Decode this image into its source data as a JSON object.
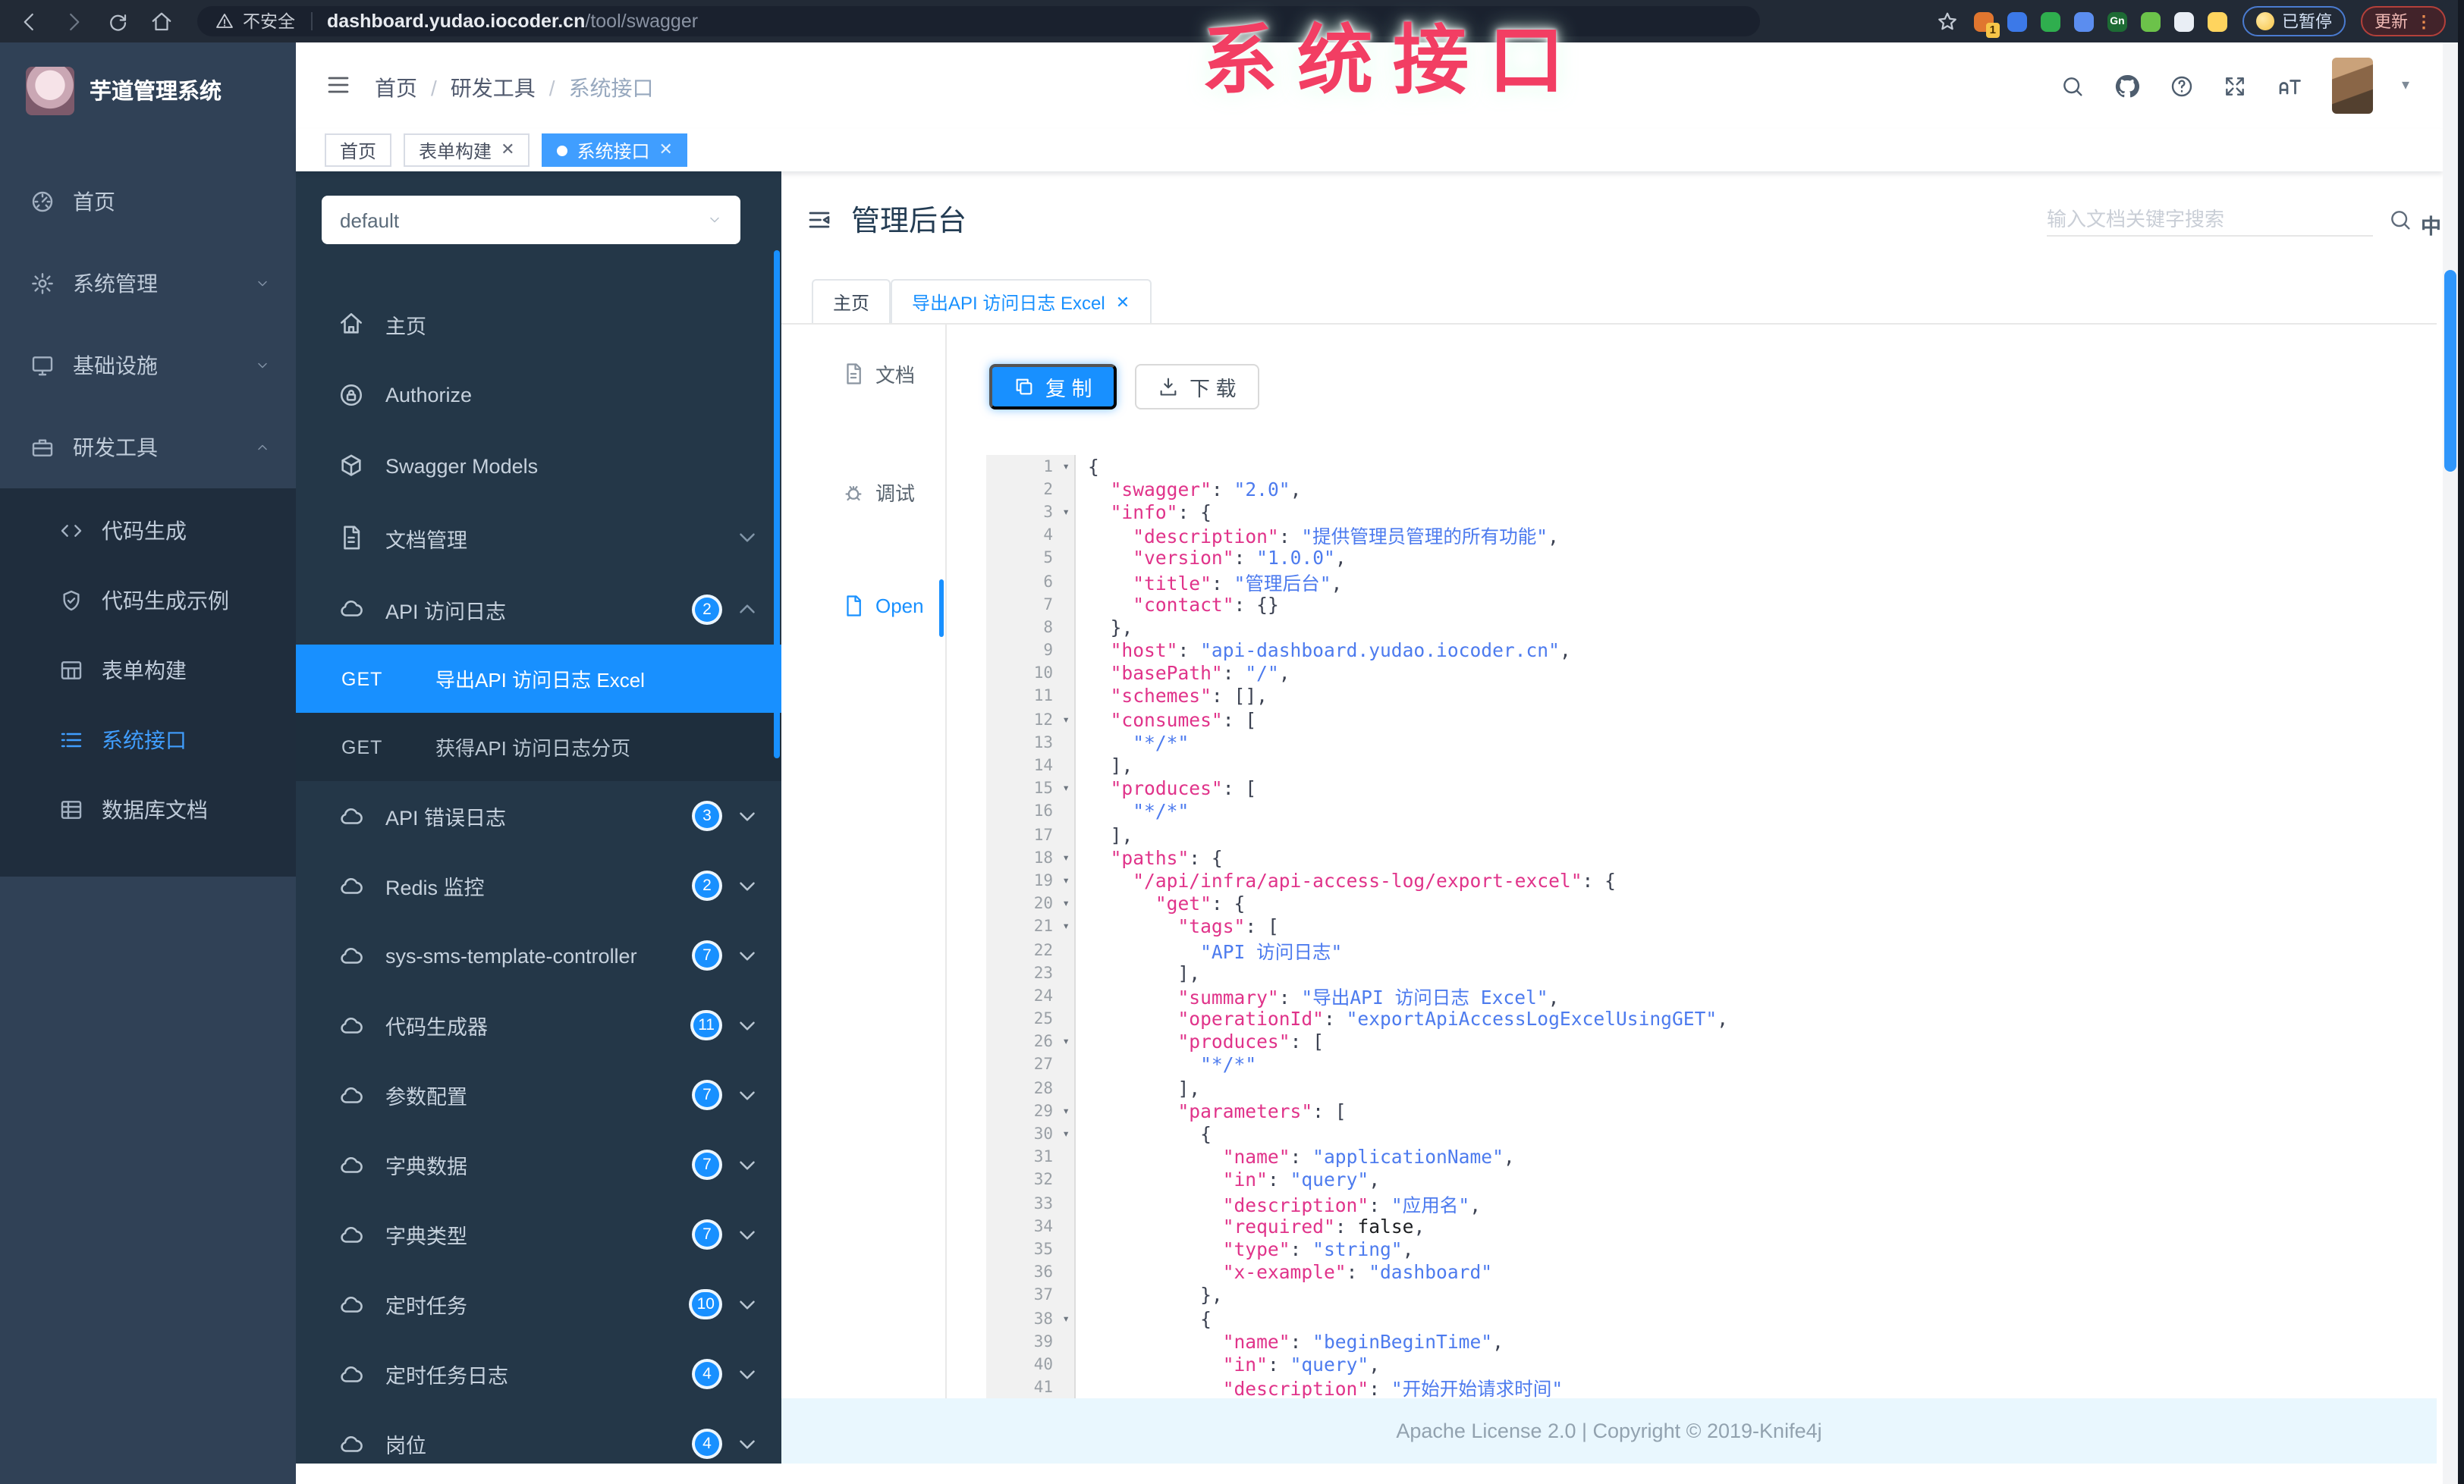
{
  "watermark": "系统接口",
  "colors": {
    "accent": "#1890ff",
    "sidebar": "#304156",
    "sidebar_submenu": "#1f2d3d",
    "swagger_sidebar": "#243748",
    "active_tag": "#409eff",
    "watermark": "#f23e63",
    "code_key": "#e0338a",
    "code_string": "#4d7bee",
    "footer_bg": "#e9f7fe"
  },
  "browser": {
    "security_label": "不安全",
    "url_host": "dashboard.yudao.iocoder.cn",
    "url_path": "/tool/swagger",
    "paused_label": "已暂停",
    "update_label": "更新",
    "menu_dots": "⋮",
    "extensions": [
      {
        "color": "#e0762f",
        "badge": "1"
      },
      {
        "color": "#3c79e8"
      },
      {
        "color": "#2fae4e"
      },
      {
        "color": "#5b8def"
      },
      {
        "color": "#1d6b34",
        "label": "Gn"
      },
      {
        "color": "#6cc24a"
      },
      {
        "color": "#e9eef5"
      },
      {
        "color": "#ffd45e"
      }
    ]
  },
  "app": {
    "logo_title": "芋道管理系统",
    "breadcrumb": [
      "首页",
      "研发工具",
      "系统接口"
    ],
    "tags": [
      {
        "label": "首页"
      },
      {
        "label": "表单构建",
        "closable": true
      },
      {
        "label": "系统接口",
        "closable": true,
        "active": true
      }
    ]
  },
  "sidebar": {
    "items": [
      {
        "icon": "dash",
        "label": "首页"
      },
      {
        "icon": "gear",
        "label": "系统管理",
        "chevron": "down"
      },
      {
        "icon": "monitor",
        "label": "基础设施",
        "chevron": "down"
      },
      {
        "icon": "briefcase",
        "label": "研发工具",
        "chevron": "up"
      }
    ],
    "sub_items": [
      {
        "icon": "code",
        "label": "代码生成"
      },
      {
        "icon": "shield",
        "label": "代码生成示例"
      },
      {
        "icon": "table",
        "label": "表单构建"
      },
      {
        "icon": "list",
        "label": "系统接口",
        "active": true
      },
      {
        "icon": "db",
        "label": "数据库文档"
      }
    ]
  },
  "swagger_nav": {
    "group_select": "default",
    "items": [
      {
        "icon": "house",
        "label": "主页"
      },
      {
        "icon": "lock",
        "label": "Authorize"
      },
      {
        "icon": "cube",
        "label": "Swagger Models"
      },
      {
        "icon": "doc",
        "label": "文档管理",
        "chevron": "down"
      },
      {
        "icon": "cloud",
        "label": "API 访问日志",
        "badge": "2",
        "chevron": "up"
      }
    ],
    "operations": [
      {
        "method": "GET",
        "label": "导出API 访问日志 Excel",
        "active": true
      },
      {
        "method": "GET",
        "label": "获得API 访问日志分页"
      }
    ],
    "groups": [
      {
        "label": "API 错误日志",
        "badge": "3"
      },
      {
        "label": "Redis 监控",
        "badge": "2"
      },
      {
        "label": "sys-sms-template-controller",
        "badge": "7"
      },
      {
        "label": "代码生成器",
        "badge": "11"
      },
      {
        "label": "参数配置",
        "badge": "7"
      },
      {
        "label": "字典数据",
        "badge": "7"
      },
      {
        "label": "字典类型",
        "badge": "7"
      },
      {
        "label": "定时任务",
        "badge": "10"
      },
      {
        "label": "定时任务日志",
        "badge": "4"
      },
      {
        "label": "岗位",
        "badge": "4"
      }
    ]
  },
  "main": {
    "title": "管理后台",
    "search_placeholder": "输入文档关键字搜索",
    "lang_icon": "中",
    "tabs": [
      {
        "label": "主页"
      },
      {
        "label": "导出API 访问日志 Excel",
        "closable": true,
        "active": true
      }
    ],
    "doc_nav": [
      {
        "icon": "doc",
        "label": "文档"
      },
      {
        "icon": "bug",
        "label": "调试"
      },
      {
        "icon": "file",
        "label": "Open",
        "active": true
      }
    ],
    "copy_label": "复 制",
    "download_label": "下 载",
    "fold_lines": [
      1,
      3,
      12,
      15,
      18,
      19,
      20,
      21,
      26,
      29,
      30,
      38
    ],
    "code_lines": [
      "{",
      "  \"swagger\": \"2.0\",",
      "  \"info\": {",
      "    \"description\": \"提供管理员管理的所有功能\",",
      "    \"version\": \"1.0.0\",",
      "    \"title\": \"管理后台\",",
      "    \"contact\": {}",
      "  },",
      "  \"host\": \"api-dashboard.yudao.iocoder.cn\",",
      "  \"basePath\": \"/\",",
      "  \"schemes\": [],",
      "  \"consumes\": [",
      "    \"*/*\"",
      "  ],",
      "  \"produces\": [",
      "    \"*/*\"",
      "  ],",
      "  \"paths\": {",
      "    \"/api/infra/api-access-log/export-excel\": {",
      "      \"get\": {",
      "        \"tags\": [",
      "          \"API 访问日志\"",
      "        ],",
      "        \"summary\": \"导出API 访问日志 Excel\",",
      "        \"operationId\": \"exportApiAccessLogExcelUsingGET\",",
      "        \"produces\": [",
      "          \"*/*\"",
      "        ],",
      "        \"parameters\": [",
      "          {",
      "            \"name\": \"applicationName\",",
      "            \"in\": \"query\",",
      "            \"description\": \"应用名\",",
      "            \"required\": false,",
      "            \"type\": \"string\",",
      "            \"x-example\": \"dashboard\"",
      "          },",
      "          {",
      "            \"name\": \"beginBeginTime\",",
      "            \"in\": \"query\",",
      "            \"description\": \"开始开始请求时间\"",
      "    ",
      "    "
    ],
    "footer": "Apache License 2.0 | Copyright © 2019-Knife4j"
  }
}
